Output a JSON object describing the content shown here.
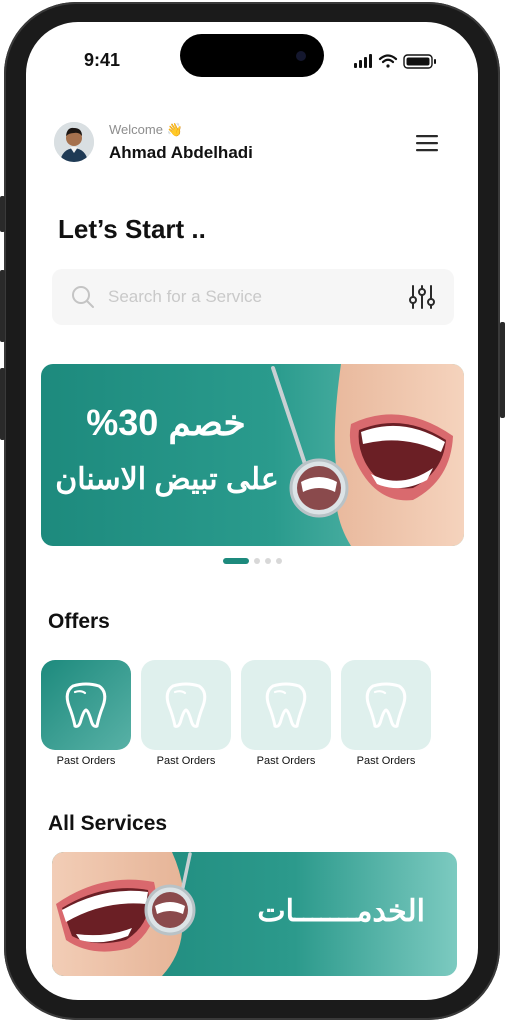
{
  "status_bar": {
    "time": "9:41"
  },
  "profile": {
    "welcome": "Welcome 👋",
    "name": "Ahmad Abdelhadi"
  },
  "heading": "Let’s Start ..",
  "search": {
    "placeholder": "Search for a Service"
  },
  "promo_banner": {
    "line1": "خصم 30%",
    "line2": "على تبيض الاسنان",
    "active_slide": 1,
    "slide_count": 4
  },
  "offers": {
    "title": "Offers",
    "items": [
      {
        "label": "Past Orders",
        "icon": "tooth-icon",
        "active": true
      },
      {
        "label": "Past Orders",
        "icon": "tooth-icon",
        "active": false
      },
      {
        "label": "Past Orders",
        "icon": "tooth-icon",
        "active": false
      },
      {
        "label": "Past Orders",
        "icon": "tooth-icon",
        "active": false
      }
    ]
  },
  "services": {
    "title": "All Services",
    "banner_text": "الخدمـــــــات"
  },
  "colors": {
    "accent": "#1d8a7d",
    "accent_light": "#dff0ed",
    "search_bg": "#f6f6f6"
  }
}
